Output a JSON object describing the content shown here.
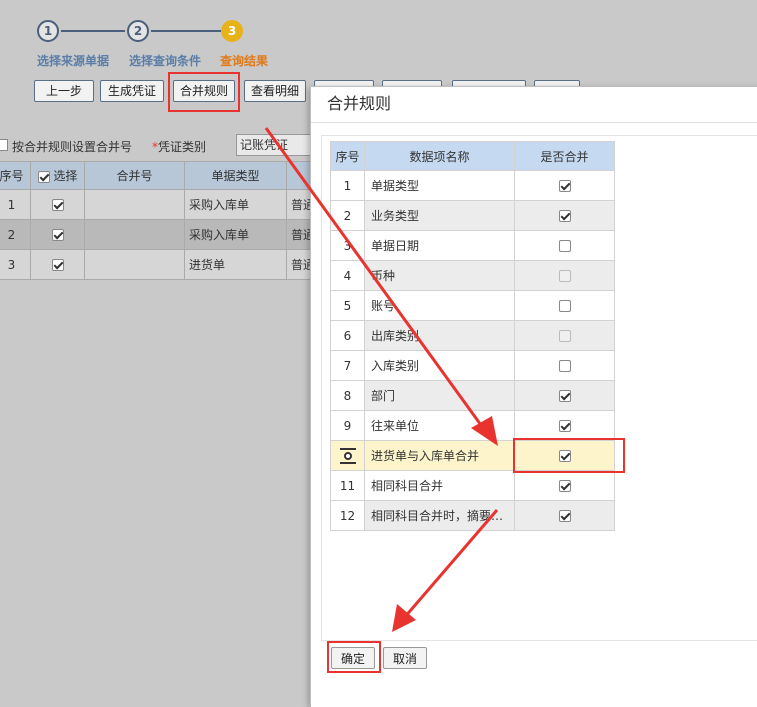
{
  "stepper": {
    "steps": [
      {
        "num": "1",
        "label": "选择来源单据"
      },
      {
        "num": "2",
        "label": "选择查询条件"
      },
      {
        "num": "3",
        "label": "查询结果"
      }
    ]
  },
  "toolbar": {
    "prev_label": "上一步",
    "voucher_label": "生成凭证",
    "merge_rule_label": "合并规则",
    "view_detail_label": "查看明细"
  },
  "options": {
    "merge_by_rule_label": "按合并规则设置合并号",
    "voucher_type_required_mark": "*",
    "voucher_type_label": "凭证类别",
    "voucher_type_value": "记账凭证"
  },
  "bg_table": {
    "headers": [
      "序号",
      "选择",
      "合并号",
      "单据类型"
    ],
    "rows": [
      {
        "no": "1",
        "checked": true,
        "merge": "",
        "type": "采购入库单",
        "extra": "普通"
      },
      {
        "no": "2",
        "checked": true,
        "merge": "",
        "type": "采购入库单",
        "extra": "普通"
      },
      {
        "no": "3",
        "checked": true,
        "merge": "",
        "type": "进货单",
        "extra": "普通"
      }
    ]
  },
  "dialog": {
    "title": "合并规则",
    "headers": [
      "序号",
      "数据项名称",
      "是否合并"
    ],
    "rows": [
      {
        "no": "1",
        "name": "单据类型",
        "merge": true,
        "enabled": true
      },
      {
        "no": "2",
        "name": "业务类型",
        "merge": true,
        "enabled": true
      },
      {
        "no": "3",
        "name": "单据日期",
        "merge": false,
        "enabled": true
      },
      {
        "no": "4",
        "name": "币种",
        "merge": false,
        "enabled": false
      },
      {
        "no": "5",
        "name": "账号",
        "merge": false,
        "enabled": true
      },
      {
        "no": "6",
        "name": "出库类别",
        "merge": false,
        "enabled": false
      },
      {
        "no": "7",
        "name": "入库类别",
        "merge": false,
        "enabled": true
      },
      {
        "no": "8",
        "name": "部门",
        "merge": true,
        "enabled": true
      },
      {
        "no": "9",
        "name": "往来单位",
        "merge": true,
        "enabled": true
      },
      {
        "no": "",
        "name": "进货单与入库单合并",
        "merge": true,
        "enabled": true,
        "current": true
      },
      {
        "no": "11",
        "name": "相同科目合并",
        "merge": true,
        "enabled": true
      },
      {
        "no": "12",
        "name": "相同科目合并时，摘要合并",
        "merge": true,
        "enabled": true
      }
    ],
    "ok_label": "确定",
    "cancel_label": "取消"
  },
  "colors": {
    "highlight": "#e8332f",
    "header_blue": "#c5d9f0",
    "step_active": "#e8b21a"
  }
}
